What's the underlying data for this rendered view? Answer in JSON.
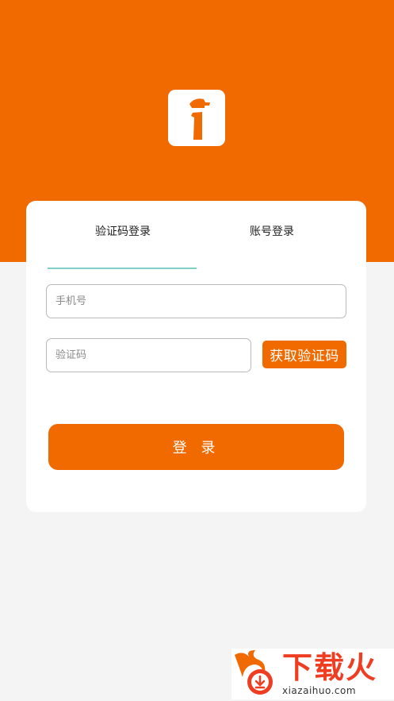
{
  "colors": {
    "brand": "#f06a00",
    "tab_indicator": "#7fcfc6",
    "page_background": "#f4f4f4",
    "watermark_red": "#ef3d22"
  },
  "header": {
    "logo_icon": "app-logo-icon"
  },
  "tabs": [
    {
      "label": "验证码登录",
      "active": true
    },
    {
      "label": "账号登录",
      "active": false
    }
  ],
  "form": {
    "phone_placeholder": "手机号",
    "code_placeholder": "验证码",
    "get_code_label": "获取验证码",
    "login_label": "登 录"
  },
  "watermark": {
    "title": "下载火",
    "domain": "xiazaihuo.com",
    "icon": "flame-download-icon"
  }
}
